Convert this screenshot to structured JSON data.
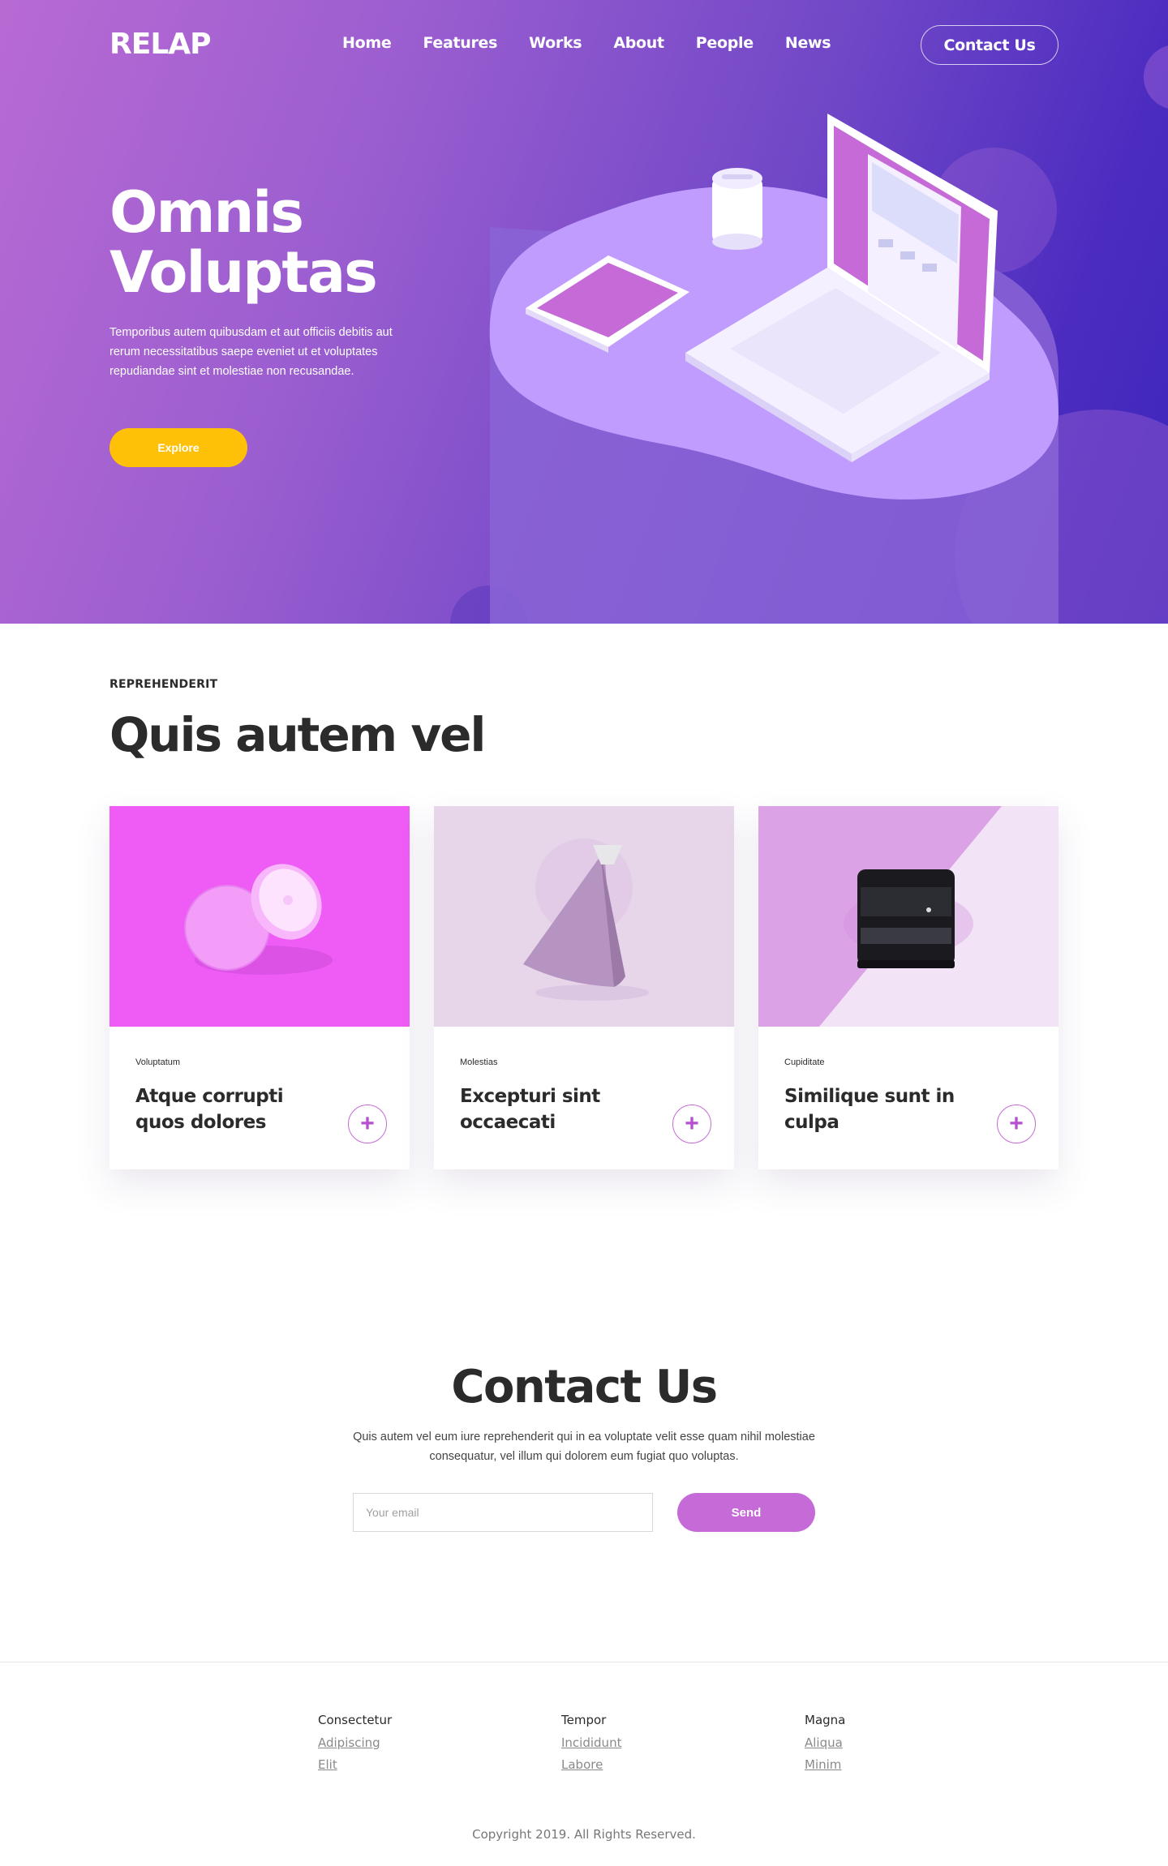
{
  "brand": {
    "logo": "RELAP"
  },
  "nav": {
    "items": [
      {
        "label": "Home"
      },
      {
        "label": "Features"
      },
      {
        "label": "Works"
      },
      {
        "label": "About"
      },
      {
        "label": "People"
      },
      {
        "label": "News"
      }
    ],
    "contact_label": "Contact Us"
  },
  "hero": {
    "title": "Omnis Voluptas",
    "text": "Temporibus autem quibusdam et aut officiis debitis aut rerum necessitatibus saepe eveniet ut et voluptates repudiandae sint et molestiae non recusandae.",
    "button_label": "Explore"
  },
  "services": {
    "eyebrow": "REPREHENDERIT",
    "title": "Quis autem vel",
    "cards": [
      {
        "category": "Voluptatum",
        "title": "Atque corrupti quos dolores",
        "action_icon": "plus-icon"
      },
      {
        "category": "Molestias",
        "title": "Excepturi sint occaecati",
        "action_icon": "plus-icon"
      },
      {
        "category": "Cupiditate",
        "title": "Similique sunt in culpa",
        "action_icon": "plus-icon"
      }
    ]
  },
  "contact": {
    "title": "Contact Us",
    "text": "Quis autem vel eum iure reprehenderit qui in ea voluptate velit esse quam nihil molestiae consequatur, vel illum qui dolorem eum fugiat quo voluptas.",
    "email_placeholder": "Your email",
    "email_value": "",
    "send_label": "Send"
  },
  "footer": {
    "columns": [
      {
        "heading": "Consectetur",
        "links": [
          "Adipiscing",
          "Elit"
        ]
      },
      {
        "heading": "Tempor",
        "links": [
          "Incididunt",
          "Labore"
        ]
      },
      {
        "heading": "Magna",
        "links": [
          "Aliqua",
          "Minim"
        ]
      }
    ],
    "copyright": "Copyright 2019. All Rights Reserved."
  },
  "colors": {
    "hero_gradient_start": "#b86ad3",
    "hero_gradient_end": "#3d26bb",
    "accent_yellow": "#ffc107",
    "accent_purple": "#c56ad6",
    "text_dark": "#2b2b2b"
  }
}
